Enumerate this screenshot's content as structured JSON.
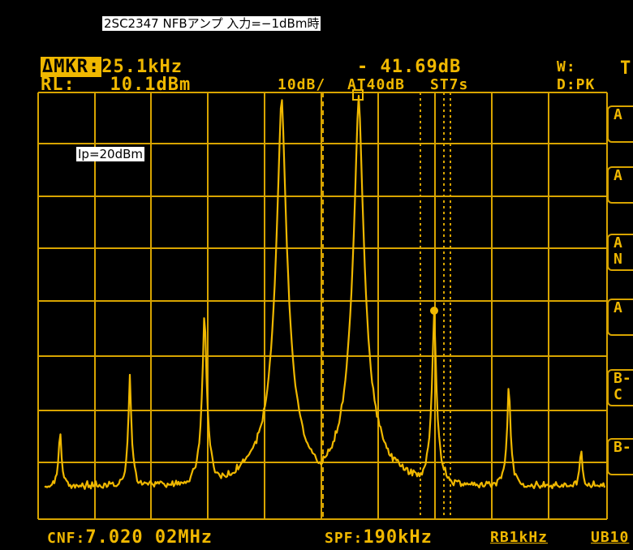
{
  "annotation": {
    "title": "2SC2347 NFBアンプ 入力=−1dBm時",
    "ip_label": "Ip=20dBm"
  },
  "readout": {
    "marker_label": "ΔMKR:",
    "marker_freq": "25.1kHz",
    "marker_level": "- 41.69dB",
    "ref_level_label": "RL:",
    "ref_level_value": "10.1dBm",
    "scale": "10dB/",
    "atten": "AT40dB",
    "sweep": "ST7s",
    "window": "W:",
    "detector": "D:PK",
    "top_right": "T",
    "center_label": "CNF:",
    "center_value": "7.020 02MHz",
    "span_label": "SPF:",
    "span_value": "190kHz",
    "rbw": "RB1kHz",
    "vbw_partial": "UB10"
  },
  "softkeys": [
    "A",
    "A",
    "A N",
    "A",
    "B- C",
    "B-"
  ],
  "colors": {
    "trace": "#f0b800",
    "grid": "#d8a400",
    "background": "#000000"
  }
}
